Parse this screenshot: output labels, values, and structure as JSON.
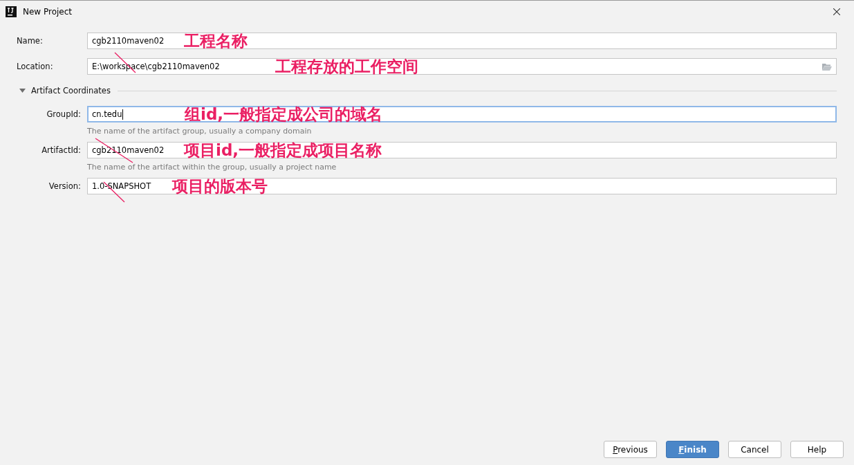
{
  "window": {
    "title": "New Project"
  },
  "fields": [
    {
      "label": "Name:",
      "value": "cgb2110maven02",
      "annotation": "工程名称",
      "focused": false,
      "browse": false
    },
    {
      "label": "Location:",
      "value": "E:\\workspace\\cgb2110maven02",
      "annotation": "工程存放的工作空间",
      "focused": false,
      "browse": true
    }
  ],
  "section": {
    "title": "Artifact Coordinates",
    "expanded": true,
    "fields": [
      {
        "label": "GroupId:",
        "value": "cn.tedu",
        "hint": "The name of the artifact group, usually a company domain",
        "annotation": "组id,一般指定成公司的域名",
        "focused": true
      },
      {
        "label": "ArtifactId:",
        "value": "cgb2110maven02",
        "hint": "The name of the artifact within the group, usually a project name",
        "annotation": "项目id,一般指定成项目名称",
        "focused": false
      },
      {
        "label": "Version:",
        "value": "1.0-SNAPSHOT",
        "annotation": "项目的版本号",
        "focused": false
      }
    ]
  },
  "buttons": [
    {
      "mnemonic": "P",
      "rest": "revious",
      "primary": false
    },
    {
      "mnemonic": "F",
      "rest": "inish",
      "primary": true
    },
    {
      "rest": "Cancel",
      "primary": false
    },
    {
      "rest": "Help",
      "primary": false
    }
  ]
}
